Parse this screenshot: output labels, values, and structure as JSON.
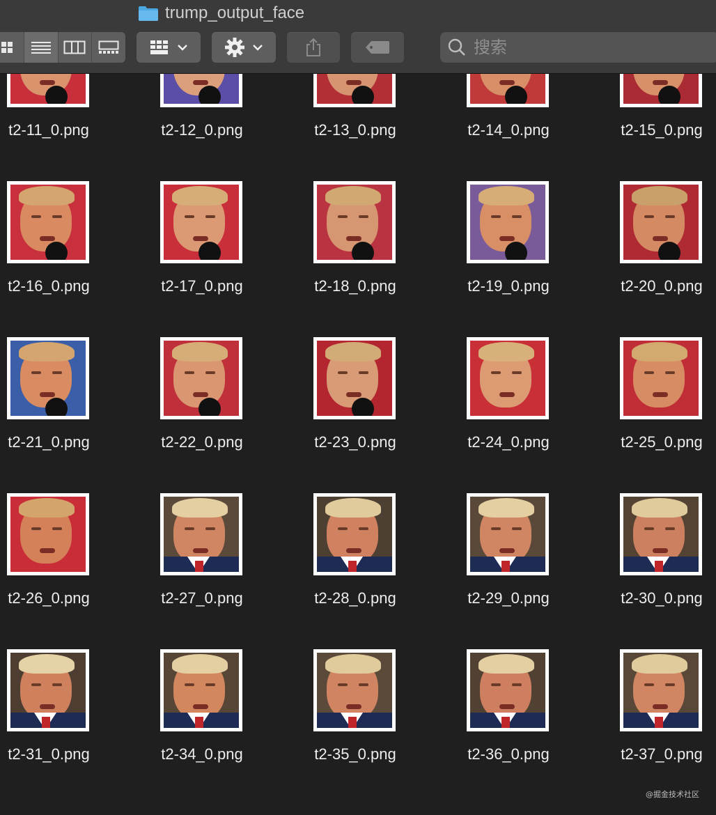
{
  "window": {
    "folder_name": "trump_output_face"
  },
  "toolbar": {
    "view_buttons": [
      "icon-view",
      "list-view",
      "column-view",
      "gallery-view"
    ],
    "group_button": "grid-group-icon",
    "action_button": "gear-icon",
    "share_button": "share-icon",
    "tag_button": "tag-icon",
    "search_placeholder": "搜索"
  },
  "files": [
    {
      "name": "t2-11_0.png",
      "bg": "#c7303a",
      "skin": "#d9946d",
      "hair": "#cfa572",
      "style": "mic"
    },
    {
      "name": "t2-12_0.png",
      "bg": "#5b4ea6",
      "skin": "#dba07b",
      "hair": "#d2ab74",
      "style": "mic"
    },
    {
      "name": "t2-13_0.png",
      "bg": "#b22f35",
      "skin": "#d79470",
      "hair": "#cfa572",
      "style": "mic"
    },
    {
      "name": "t2-14_0.png",
      "bg": "#c13a3a",
      "skin": "#d88e66",
      "hair": "#cfa572",
      "style": "mic"
    },
    {
      "name": "t2-15_0.png",
      "bg": "#aa2b34",
      "skin": "#d89068",
      "hair": "#d2ab74",
      "style": "mic"
    },
    {
      "name": "t2-16_0.png",
      "bg": "#c8303d",
      "skin": "#d98a60",
      "hair": "#d4a56e",
      "style": "mic"
    },
    {
      "name": "t2-17_0.png",
      "bg": "#c92f3a",
      "skin": "#db9a73",
      "hair": "#d6ad76",
      "style": "mic"
    },
    {
      "name": "t2-18_0.png",
      "bg": "#b93340",
      "skin": "#d79672",
      "hair": "#d1a872",
      "style": "mic"
    },
    {
      "name": "t2-19_0.png",
      "bg": "#7a5b9a",
      "skin": "#d88f66",
      "hair": "#d6ad76",
      "style": "mic"
    },
    {
      "name": "t2-20_0.png",
      "bg": "#b02a33",
      "skin": "#d48a63",
      "hair": "#c9a06a",
      "style": "mic"
    },
    {
      "name": "t2-21_0.png",
      "bg": "#3a5ea8",
      "skin": "#d98b61",
      "hair": "#d4a56e",
      "style": "mic"
    },
    {
      "name": "t2-22_0.png",
      "bg": "#c0303b",
      "skin": "#da9670",
      "hair": "#d6ad76",
      "style": "mic"
    },
    {
      "name": "t2-23_0.png",
      "bg": "#b3262f",
      "skin": "#d99a76",
      "hair": "#d3ab76",
      "style": "mic"
    },
    {
      "name": "t2-24_0.png",
      "bg": "#c82f36",
      "skin": "#dc9b72",
      "hair": "#d8b07a",
      "style": "plain"
    },
    {
      "name": "t2-25_0.png",
      "bg": "#c02d36",
      "skin": "#d88c63",
      "hair": "#d2a96f",
      "style": "plain"
    },
    {
      "name": "t2-26_0.png",
      "bg": "#c92d38",
      "skin": "#d4815a",
      "hair": "#d3a46c",
      "style": "plain"
    },
    {
      "name": "t2-27_0.png",
      "bg": "#5b4a3a",
      "skin": "#d08563",
      "hair": "#e3cfa2",
      "style": "suit"
    },
    {
      "name": "t2-28_0.png",
      "bg": "#4e3f33",
      "skin": "#cf8160",
      "hair": "#e0cb9c",
      "style": "suit"
    },
    {
      "name": "t2-29_0.png",
      "bg": "#5a4938",
      "skin": "#d08563",
      "hair": "#e3cfa2",
      "style": "suit"
    },
    {
      "name": "t2-30_0.png",
      "bg": "#544333",
      "skin": "#cd8060",
      "hair": "#e0cb9c",
      "style": "suit"
    },
    {
      "name": "t2-31_0.png",
      "bg": "#4d3e31",
      "skin": "#cf805d",
      "hair": "#e5d2a6",
      "style": "suit"
    },
    {
      "name": "t2-34_0.png",
      "bg": "#574636",
      "skin": "#d2875f",
      "hair": "#e3cfa2",
      "style": "suit"
    },
    {
      "name": "t2-35_0.png",
      "bg": "#5b4a3a",
      "skin": "#d08462",
      "hair": "#e0cb9c",
      "style": "suit"
    },
    {
      "name": "t2-36_0.png",
      "bg": "#514132",
      "skin": "#ce7f5f",
      "hair": "#e3cfa2",
      "style": "suit"
    },
    {
      "name": "t2-37_0.png",
      "bg": "#594837",
      "skin": "#d08563",
      "hair": "#e0cb9c",
      "style": "suit"
    }
  ],
  "watermark": "@掘金技术社区"
}
